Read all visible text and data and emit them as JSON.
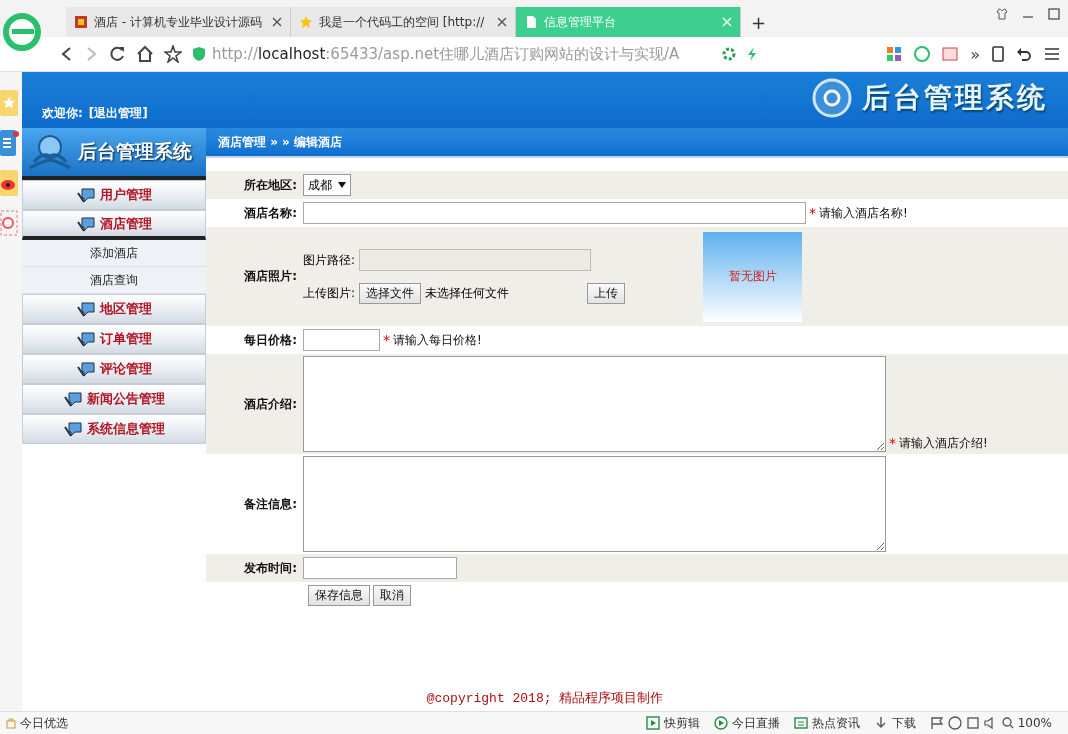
{
  "browser": {
    "tabs": [
      {
        "title": "酒店 - 计算机专业毕业设计源码",
        "selected": false
      },
      {
        "title": "我是一个代码工的空间 [http://",
        "selected": false
      },
      {
        "title": "信息管理平台",
        "selected": true
      }
    ],
    "new_tab": "+",
    "address": {
      "prefix": "http://",
      "host": "localhost",
      "rest": ":65433/asp.net住哪儿酒店订购网站的设计与实现/A"
    },
    "more": "»"
  },
  "header": {
    "welcome": "欢迎你:",
    "logout": "[退出管理]",
    "banner_title": "后台管理系统"
  },
  "sidebar": {
    "logo_title": "后台管理系统",
    "menu": [
      {
        "label": "用户管理",
        "expanded": false
      },
      {
        "label": "酒店管理",
        "expanded": true,
        "children": [
          {
            "label": "添加酒店"
          },
          {
            "label": "酒店查询"
          }
        ]
      },
      {
        "label": "地区管理",
        "expanded": false
      },
      {
        "label": "订单管理",
        "expanded": false
      },
      {
        "label": "评论管理",
        "expanded": false
      },
      {
        "label": "新闻公告管理",
        "expanded": false
      },
      {
        "label": "系统信息管理",
        "expanded": false
      }
    ]
  },
  "breadcrumb": "酒店管理 » » 编辑酒店",
  "form": {
    "fields": [
      {
        "kind": "select",
        "label": "所在地区:",
        "value": "成都"
      },
      {
        "kind": "text",
        "label": "酒店名称:",
        "required_mark": "*",
        "hint": "请输入酒店名称!"
      },
      {
        "kind": "photo",
        "label": "酒店照片:",
        "path_label": "图片路径:",
        "upload_label": "上传图片:",
        "choose_button": "选择文件",
        "no_file": "未选择任何文件",
        "upload_button": "上传",
        "preview_text": "暂无图片"
      },
      {
        "kind": "text",
        "label": "每日价格:",
        "required_mark": "*",
        "hint": "请输入每日价格!"
      },
      {
        "kind": "textarea",
        "label": "酒店介绍:",
        "required_mark": "*",
        "hint": "请输入酒店介绍!"
      },
      {
        "kind": "textarea",
        "label": "备注信息:"
      },
      {
        "kind": "text",
        "label": "发布时间:"
      }
    ],
    "buttons": [
      "保存信息",
      "取消"
    ]
  },
  "footer": "@copyright 2018; 精品程序项目制作",
  "status_bar": {
    "left": "今日优选",
    "items": [
      {
        "label": "快剪辑"
      },
      {
        "label": "今日直播"
      },
      {
        "label": "热点资讯"
      },
      {
        "label": "下载"
      }
    ],
    "zoom": "100%"
  }
}
